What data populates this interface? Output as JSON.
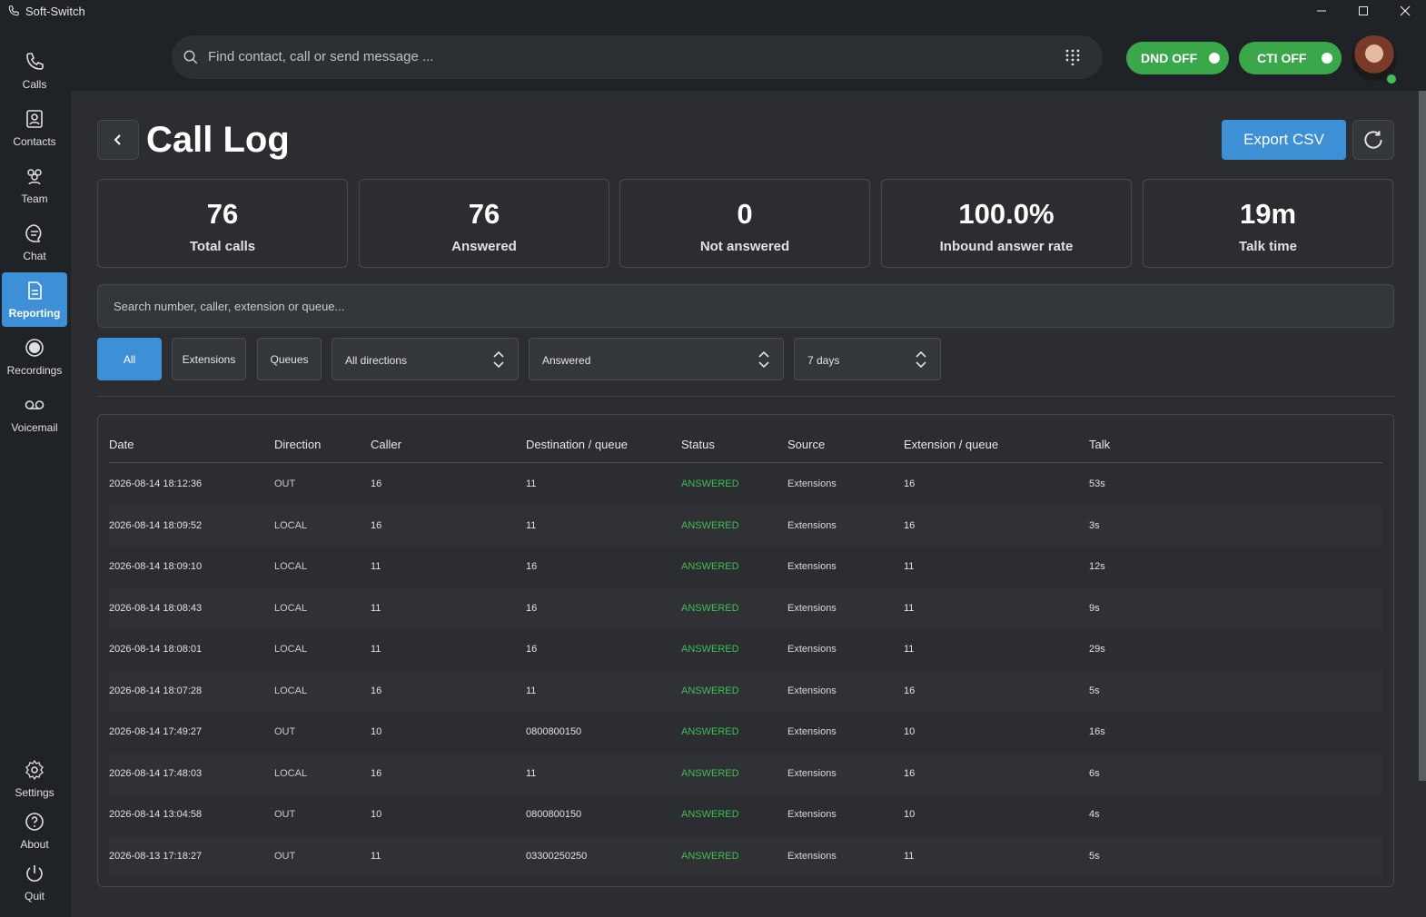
{
  "window": {
    "title": "Soft-Switch"
  },
  "sidebar": {
    "items": [
      {
        "label": "Calls",
        "icon": "phone-icon"
      },
      {
        "label": "Contacts",
        "icon": "contacts-icon"
      },
      {
        "label": "Team",
        "icon": "team-icon"
      },
      {
        "label": "Chat",
        "icon": "chat-icon"
      },
      {
        "label": "Reporting",
        "icon": "report-icon",
        "active": true
      },
      {
        "label": "Recordings",
        "icon": "record-icon"
      },
      {
        "label": "Voicemail",
        "icon": "voicemail-icon"
      }
    ],
    "bottom": [
      {
        "label": "Settings",
        "icon": "gear-icon"
      },
      {
        "label": "About",
        "icon": "help-icon"
      },
      {
        "label": "Quit",
        "icon": "power-icon"
      }
    ]
  },
  "topbar": {
    "search_placeholder": "Find contact, call or send message ...",
    "dnd_label": "DND OFF",
    "cti_label": "CTI OFF",
    "toggle_color": "#3aa84a"
  },
  "page": {
    "title": "Call Log",
    "export_label": "Export CSV",
    "accent": "#3d8fd6"
  },
  "stats": [
    {
      "value": "76",
      "label": "Total calls"
    },
    {
      "value": "76",
      "label": "Answered"
    },
    {
      "value": "0",
      "label": "Not answered"
    },
    {
      "value": "100.0%",
      "label": "Inbound answer rate"
    },
    {
      "value": "19m",
      "label": "Talk time"
    }
  ],
  "filters": {
    "search_placeholder": "Search number, caller, extension or queue...",
    "chips": [
      "All",
      "Extensions",
      "Queues"
    ],
    "active_chip": "All",
    "direction": "All directions",
    "status": "Answered",
    "period": "7 days"
  },
  "table": {
    "columns": [
      "Date",
      "Direction",
      "Caller",
      "Destination / queue",
      "Status",
      "Source",
      "Extension / queue",
      "Talk"
    ],
    "rows": [
      [
        "2026-08-14 18:12:36",
        "OUT",
        "16",
        "11",
        "ANSWERED",
        "Extensions",
        "16",
        "53s"
      ],
      [
        "2026-08-14 18:09:52",
        "LOCAL",
        "16",
        "11",
        "ANSWERED",
        "Extensions",
        "16",
        "3s"
      ],
      [
        "2026-08-14 18:09:10",
        "LOCAL",
        "11",
        "16",
        "ANSWERED",
        "Extensions",
        "11",
        "12s"
      ],
      [
        "2026-08-14 18:08:43",
        "LOCAL",
        "11",
        "16",
        "ANSWERED",
        "Extensions",
        "11",
        "9s"
      ],
      [
        "2026-08-14 18:08:01",
        "LOCAL",
        "11",
        "16",
        "ANSWERED",
        "Extensions",
        "11",
        "29s"
      ],
      [
        "2026-08-14 18:07:28",
        "LOCAL",
        "16",
        "11",
        "ANSWERED",
        "Extensions",
        "16",
        "5s"
      ],
      [
        "2026-08-14 17:49:27",
        "OUT",
        "10",
        "0800800150",
        "ANSWERED",
        "Extensions",
        "10",
        "16s"
      ],
      [
        "2026-08-14 17:48:03",
        "LOCAL",
        "16",
        "11",
        "ANSWERED",
        "Extensions",
        "16",
        "6s"
      ],
      [
        "2026-08-14 13:04:58",
        "OUT",
        "10",
        "0800800150",
        "ANSWERED",
        "Extensions",
        "10",
        "4s"
      ],
      [
        "2026-08-13 17:18:27",
        "OUT",
        "11",
        "03300250250",
        "ANSWERED",
        "Extensions",
        "11",
        "5s"
      ]
    ],
    "status_color": "#3fbf54"
  }
}
